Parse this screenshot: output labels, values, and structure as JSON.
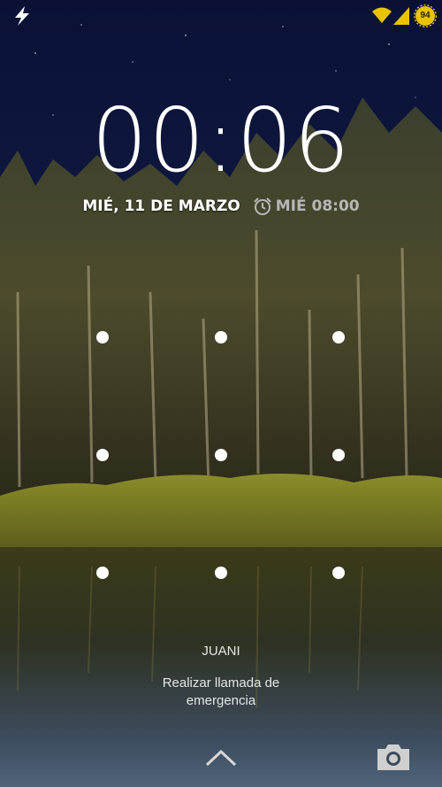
{
  "status_bar": {
    "charging_icon": "lightning-bolt-icon",
    "wifi_icon": "wifi-icon",
    "signal_icon": "cell-signal-icon",
    "battery_level": "94",
    "accent_color": "#e8c400"
  },
  "lockscreen": {
    "time": "00:06",
    "date": "MIÉ, 11 DE MARZO",
    "alarm_icon": "alarm-clock-icon",
    "next_alarm": "MIÉ 08:00",
    "pattern_grid": "3x3",
    "owner_info": "JUANI",
    "emergency_call": "Realizar llamada de emergencia",
    "unlock_icon": "chevron-up-icon",
    "camera_icon": "camera-icon"
  }
}
